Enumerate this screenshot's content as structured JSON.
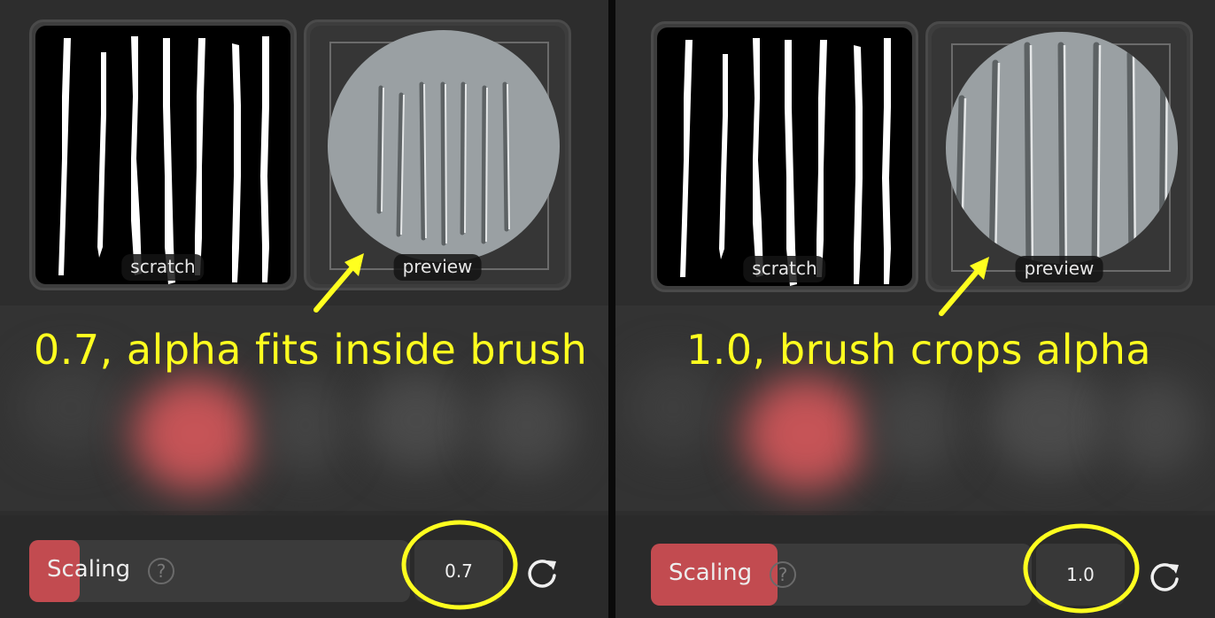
{
  "panels": [
    {
      "scratch_label": "scratch",
      "preview_label": "preview",
      "annotation": "0.7, alpha fits inside brush",
      "slider_label": "Scaling",
      "help_glyph": "?",
      "value": "0.7",
      "slider_fraction": 0.15
    },
    {
      "scratch_label": "scratch",
      "preview_label": "preview",
      "annotation": "1.0, brush crops alpha",
      "slider_label": "Scaling",
      "help_glyph": "?",
      "value": "1.0",
      "slider_fraction": 0.33
    }
  ],
  "colors": {
    "annotation": "#ffff1f",
    "accent": "#c24b50",
    "preview_disc": "#9aa0a3"
  },
  "icons": [
    "help-icon",
    "reset-icon",
    "arrow-icon"
  ]
}
